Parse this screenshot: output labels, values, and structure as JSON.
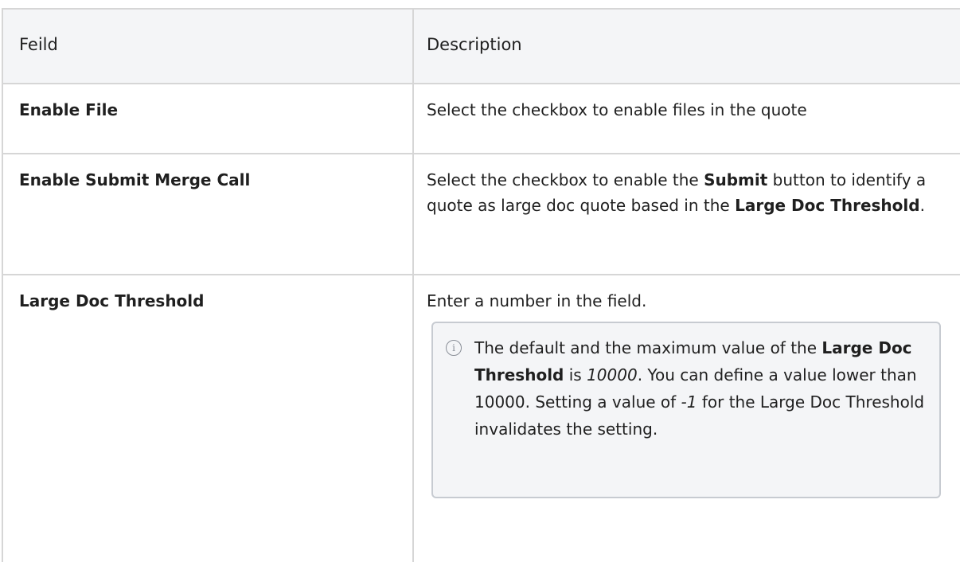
{
  "headers": {
    "field": "Feild",
    "description": "Description"
  },
  "rows": [
    {
      "field": "Enable File",
      "description": "Select the checkbox to enable files in the quote"
    },
    {
      "field": "Enable Submit Merge Call",
      "desc_part1": "Select the checkbox to enable the ",
      "desc_bold1": "Submit",
      "desc_part2": " button to identify a quote as large doc quote based in the ",
      "desc_bold2": "Large Doc Threshold",
      "desc_part3": "."
    },
    {
      "field": "Large Doc Threshold",
      "description": "Enter a number in the field.",
      "note": {
        "icon": "info-icon",
        "part1": "The default and the maximum value of the ",
        "bold1": "Large Doc Threshold",
        "part2": " is ",
        "italic1": "10000",
        "part3": ". You can define a value lower than 10000. Setting a value of ",
        "italic2": "-1",
        "part4": " for the Large Doc Threshold invalidates the setting."
      }
    }
  ]
}
